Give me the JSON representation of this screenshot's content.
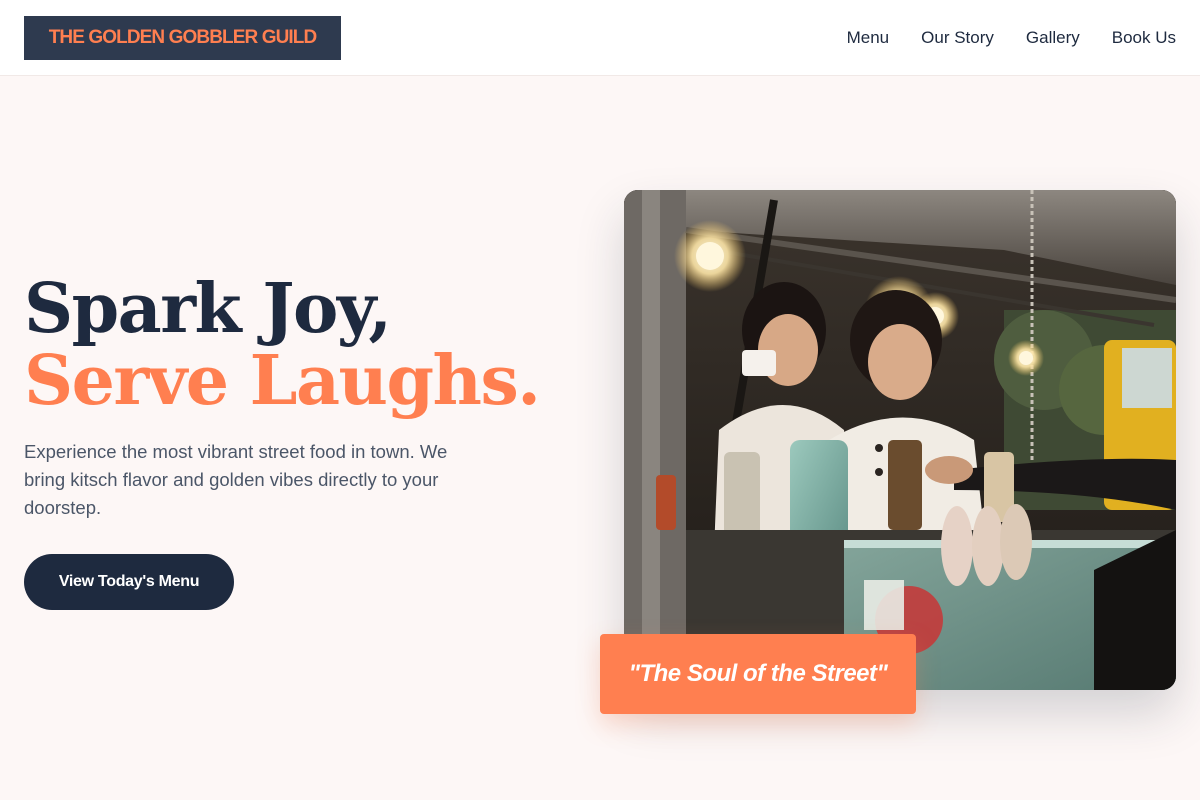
{
  "header": {
    "logo_text": "THE GOLDEN GOBBLER GUILD",
    "nav": [
      {
        "label": "Menu"
      },
      {
        "label": "Our Story"
      },
      {
        "label": "Gallery"
      },
      {
        "label": "Book Us"
      }
    ]
  },
  "hero": {
    "headline_line1": "Spark Joy,",
    "headline_line2": "Serve Laughs.",
    "subtext": "Experience the most vibrant street food in town. We bring kitsch flavor and golden vibes directly to your doorstep.",
    "cta_label": "View Today's Menu",
    "image_alt": "Street food stall photo",
    "quote": "\"The Soul of the Street\""
  },
  "colors": {
    "accent": "#ff7f50",
    "navy": "#1e2a3f",
    "background": "#fdf7f6"
  }
}
